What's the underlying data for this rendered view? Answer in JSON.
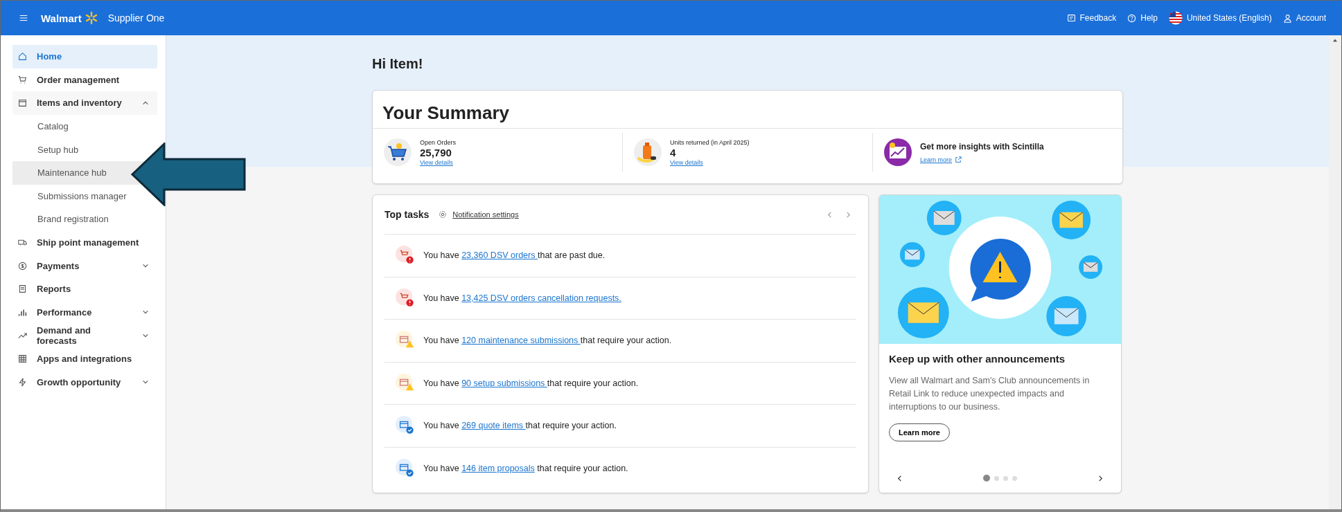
{
  "header": {
    "brand": "Walmart",
    "product": "Supplier One",
    "actions": [
      {
        "kind": "feedback",
        "label": "Feedback"
      },
      {
        "kind": "help",
        "label": "Help"
      },
      {
        "kind": "flag",
        "label": "United States (English)"
      },
      {
        "kind": "account",
        "label": "Account"
      }
    ]
  },
  "sidebar": {
    "items": [
      {
        "label": "Home",
        "selected": true
      },
      {
        "label": "Order management",
        "selected": false
      },
      {
        "label": "Items and inventory",
        "selected": false,
        "expanded": true,
        "children": [
          {
            "label": "Catalog",
            "hovered": false
          },
          {
            "label": "Setup hub",
            "hovered": false
          },
          {
            "label": "Maintenance hub",
            "hovered": true
          },
          {
            "label": "Submissions manager",
            "hovered": false
          },
          {
            "label": "Brand registration",
            "hovered": false
          }
        ]
      },
      {
        "label": "Ship point management",
        "selected": false
      },
      {
        "label": "Payments",
        "selected": false,
        "expanded": false
      },
      {
        "label": "Reports",
        "selected": false
      },
      {
        "label": "Performance",
        "selected": false,
        "expanded": false
      },
      {
        "label": "Demand and forecasts",
        "selected": false,
        "expanded": false
      },
      {
        "label": "Apps and integrations",
        "selected": false
      },
      {
        "label": "Growth opportunity",
        "selected": false,
        "expanded": false
      }
    ]
  },
  "greeting": "Hi Item!",
  "summary": {
    "title": "Your Summary",
    "stats": [
      {
        "kind": "cart",
        "label": "Open Orders",
        "value": "25,790",
        "link": "View details"
      },
      {
        "kind": "returns",
        "label": "Units returned (in April 2025)",
        "value": "4",
        "link": "View details"
      },
      {
        "kind": "insight",
        "title": "Get more insights with Scintilla",
        "link": "Learn more"
      }
    ]
  },
  "top_tasks": {
    "title": "Top tasks",
    "settings_link": "Notification settings",
    "tasks": [
      {
        "kind": "error",
        "prefix": "You have ",
        "link": "23,360 DSV orders ",
        "suffix": "that are past due."
      },
      {
        "kind": "error",
        "prefix": "You have ",
        "link": "13,425 DSV orders cancellation requests."
      },
      {
        "kind": "warning",
        "prefix": "You have ",
        "link": "120 maintenance submissions ",
        "suffix": "that require your action."
      },
      {
        "kind": "warning",
        "prefix": "You have ",
        "link": "90 setup submissions ",
        "suffix": "that require your action."
      },
      {
        "kind": "info",
        "prefix": "You have ",
        "link": "269 quote items ",
        "suffix": "that require your action."
      },
      {
        "kind": "info",
        "prefix": "You have ",
        "link": "146 item proposals",
        "suffix": " that require your action."
      }
    ]
  },
  "announcement": {
    "title": "Keep up with other announcements",
    "body": "View all Walmart and Sam's Club announcements in Retail Link to reduce unexpected impacts and interruptions to our business.",
    "button": "Learn more",
    "dots": [
      {
        "selected": true
      },
      {
        "selected": false
      },
      {
        "selected": false
      },
      {
        "selected": false
      }
    ]
  }
}
